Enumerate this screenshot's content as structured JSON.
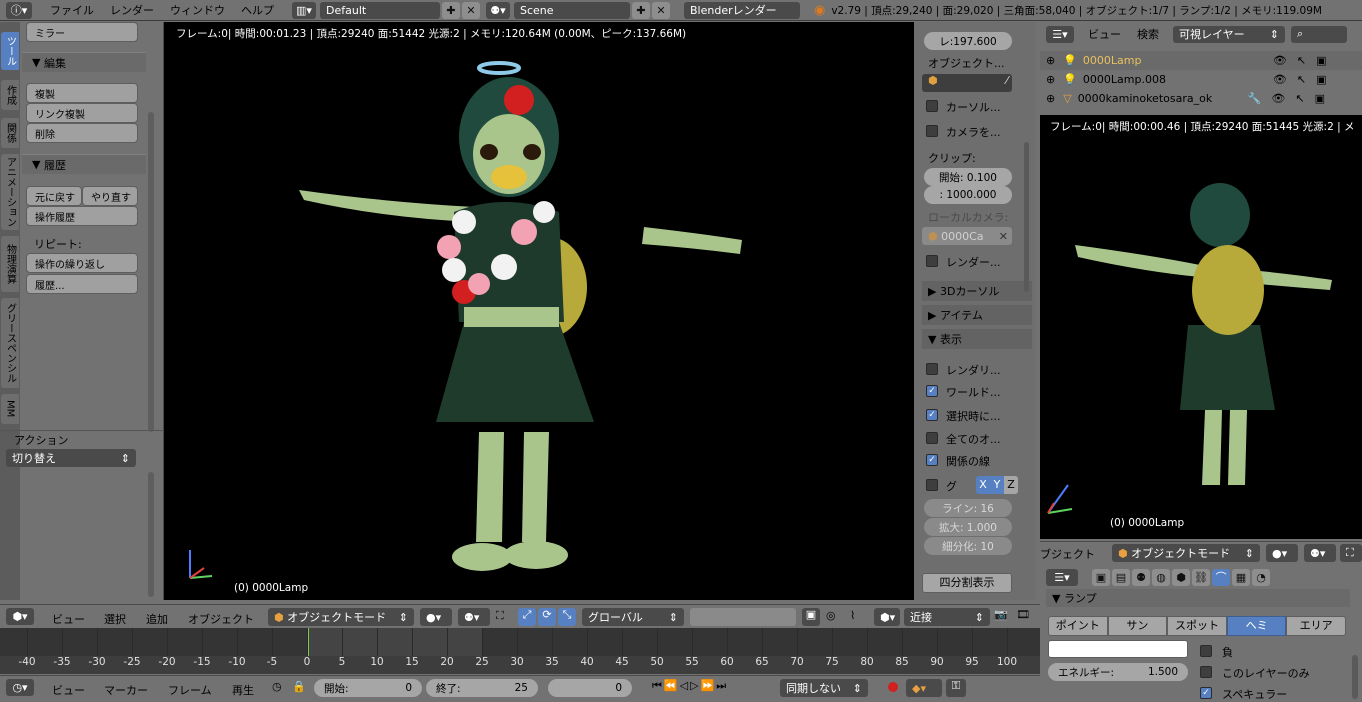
{
  "topbar": {
    "menus": [
      "ファイル",
      "レンダー",
      "ウィンドウ",
      "ヘルプ"
    ],
    "layout": "Default",
    "scene": "Scene",
    "engine": "Blenderレンダー",
    "stats": "v2.79 | 頂点:29,240 | 面:29,020 | 三角面:58,040 | オブジェクト:1/7 | ランプ:1/2 | メモリ:119.09M"
  },
  "tabs": [
    "ツール",
    "作成",
    "関係",
    "アニメーション",
    "物理演算",
    "グリースペンシル",
    "MM"
  ],
  "shelf": {
    "mirror": "ミラー",
    "edit_hdr": "編集",
    "duplicate": "複製",
    "link_dup": "リンク複製",
    "delete": "削除",
    "history_hdr": "履歴",
    "undo": "元に戻す",
    "redo": "やり直す",
    "op_history": "操作履歴",
    "repeat_lbl": "リピート:",
    "repeat_last": "操作の繰り返し",
    "history": "履歴...",
    "action_lbl": "アクション",
    "action_toggle": "切り替え"
  },
  "viewport": {
    "info": "フレーム:0| 時間:00:01.23 | 頂点:29240 面:51442 光源:2 | メモリ:120.64M (0.00M、ピーク:137.66M)",
    "object": "(0) 0000Lamp"
  },
  "npanel": {
    "lens": "レ:197.600",
    "obj_lbl": "オブジェクト...",
    "cursor_lbl": "カーソル...",
    "camera_lbl": "カメラを...",
    "clip_lbl": "クリップ:",
    "clip_start": "開始: 0.100",
    "clip_end": ": 1000.000",
    "local_cam_lbl": "ローカルカメラ:",
    "local_cam": "0000Ca",
    "render_lbl": "レンダー...",
    "cursor3d": "3Dカーソル",
    "item": "アイテム",
    "display": "表示",
    "renderonly": "レンダリ...",
    "world": "ワールド...",
    "selected": "選択時に...",
    "all": "全てのオ...",
    "relations": "関係の線",
    "grid": "グ",
    "axes": [
      "X",
      "Y",
      "Z"
    ],
    "lines": "ライン:  16",
    "scale": "拡大: 1.000",
    "subdiv": "細分化:  10",
    "quad": "四分割表示"
  },
  "outliner": {
    "view": "ビュー",
    "search": "検索",
    "filter": "可視レイヤー",
    "rows": [
      "0000Lamp",
      "0000Lamp.008",
      "0000kaminoketosara_ok"
    ]
  },
  "rviewport": {
    "info": "フレーム:0| 時間:00:00.46 | 頂点:29240 面:51445 光源:2 | メ",
    "object": "(0) 0000Lamp"
  },
  "propsbar": {
    "label": "ブジェクト",
    "mode": "オブジェクトモード"
  },
  "props": {
    "lamp_hdr": "ランプ",
    "types": [
      "ポイント",
      "サン",
      "スポット",
      "ヘミ",
      "エリア"
    ],
    "active_type": "ヘミ",
    "negative": "負",
    "energy": "エネルギー:",
    "energy_val": "1.500",
    "this_layer": "このレイヤーのみ",
    "specular": "スペキュラー"
  },
  "vphdr": {
    "view": "ビュー",
    "select": "選択",
    "add": "追加",
    "object": "オブジェクト",
    "mode": "オブジェクトモード",
    "orient": "グローバル",
    "snap": "近接"
  },
  "timeline": {
    "ticks": [
      "-40",
      "-35",
      "-30",
      "-25",
      "-20",
      "-15",
      "-10",
      "-5",
      "0",
      "5",
      "10",
      "15",
      "20",
      "25",
      "30",
      "35",
      "40",
      "45",
      "50",
      "55",
      "60",
      "65",
      "70",
      "75",
      "80",
      "85",
      "90",
      "95",
      "100"
    ]
  },
  "tlhdr": {
    "view": "ビュー",
    "marker": "マーカー",
    "frame": "フレーム",
    "play": "再生",
    "start_lbl": "開始:",
    "start": "0",
    "end_lbl": "終了:",
    "end": "25",
    "current": "0",
    "sync": "同期しない"
  }
}
